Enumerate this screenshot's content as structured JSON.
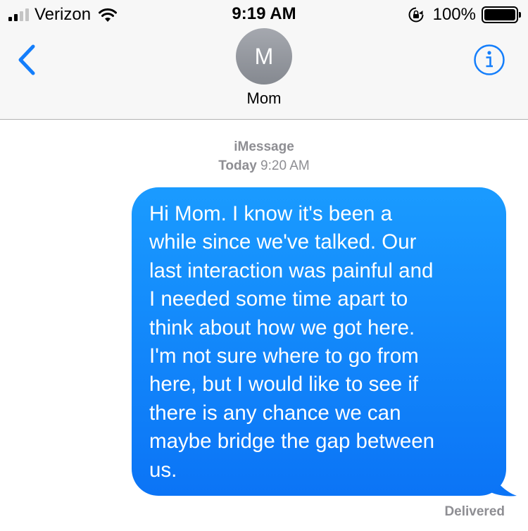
{
  "status_bar": {
    "carrier": "Verizon",
    "time": "9:19 AM",
    "battery_percent": "100%",
    "signal_bars": 4,
    "signal_bars_filled": 2,
    "icons": [
      "signal-icon",
      "wifi-icon",
      "rotation-lock-icon",
      "battery-icon"
    ]
  },
  "header": {
    "avatar_initial": "M",
    "contact_name": "Mom",
    "back_icon": "chevron-left-icon",
    "info_icon": "info-icon",
    "accent_color": "#147efb"
  },
  "conversation": {
    "service": "iMessage",
    "day": "Today",
    "time": "9:20 AM",
    "messages": [
      {
        "direction": "sent",
        "text": "Hi Mom. I know it's been a\nwhile since we've talked. Our\nlast interaction was painful and\nI needed some time apart to\nthink about how we got here.\nI'm not sure where to go from\nhere, but I would like to see if\nthere is any chance we can\nmaybe bridge the gap between\nus.",
        "bubble_color": "#0b7af8"
      }
    ],
    "status": "Delivered"
  }
}
